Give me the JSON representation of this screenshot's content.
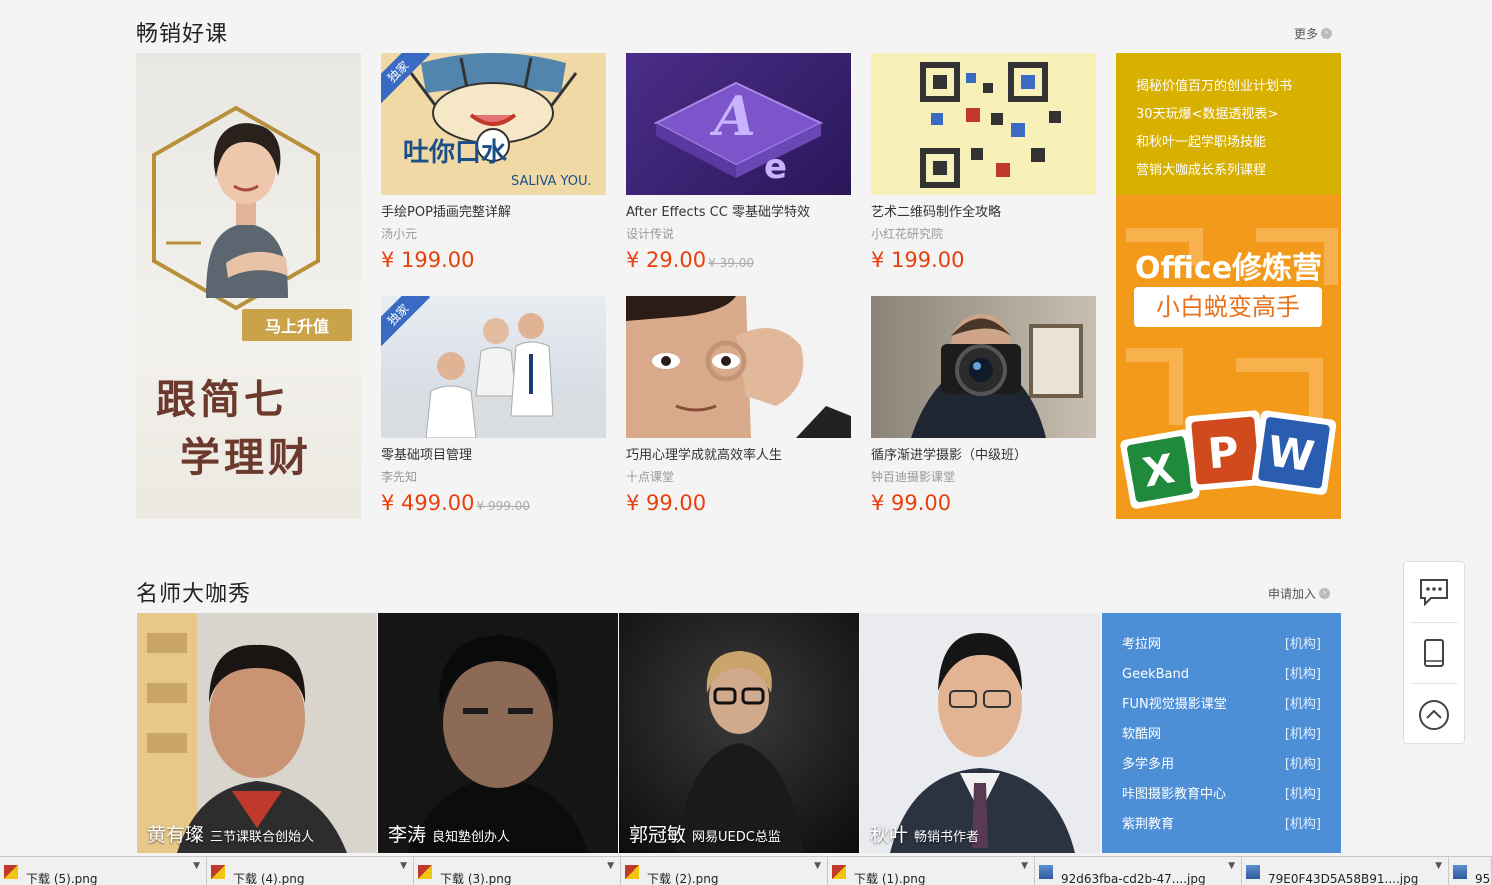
{
  "sections": {
    "bestsellers_title": "畅销好课",
    "bestsellers_more": "更多",
    "teachers_title": "名师大咖秀",
    "teachers_join": "申请加入"
  },
  "promo_left": {
    "badge": "马上升值",
    "title_line1": "跟简七",
    "title_line2": "学理财"
  },
  "courses": [
    {
      "name": "手绘POP插画完整详解",
      "org": "汤小元",
      "price": "¥ 199.00",
      "old_price": "",
      "exclusive": "独家"
    },
    {
      "name": "After Effects CC 零基础学特效",
      "org": "设计传说",
      "price": "¥ 29.00",
      "old_price": "¥ 39.00",
      "exclusive": ""
    },
    {
      "name": "艺术二维码制作全攻略",
      "org": "小红花研究院",
      "price": "¥ 199.00",
      "old_price": "",
      "exclusive": ""
    },
    {
      "name": "零基础项目管理",
      "org": "李先知",
      "price": "¥ 499.00",
      "old_price": "¥ 999.00",
      "exclusive": "独家"
    },
    {
      "name": "巧用心理学成就高效率人生",
      "org": "十点课堂",
      "price": "¥ 99.00",
      "old_price": "",
      "exclusive": ""
    },
    {
      "name": "循序渐进学摄影（中级班）",
      "org": "钟百迪摄影课堂",
      "price": "¥ 99.00",
      "old_price": "",
      "exclusive": ""
    }
  ],
  "thumb_texts": {
    "pop_big": "吐你口水",
    "pop_small": "SALIVA YOU."
  },
  "promo_right": {
    "links": [
      "揭秘价值百万的创业计划书",
      "30天玩爆<数据透视表>",
      "和秋叶一起学职场技能",
      "营销大咖成长系列课程"
    ],
    "office_title": "Office修炼营",
    "office_sub": "小白蜕变高手"
  },
  "teachers": [
    {
      "name": "黄有璨",
      "role": "三节课联合创始人"
    },
    {
      "name": "李涛",
      "role": "良知塾创办人"
    },
    {
      "name": "郭冠敏",
      "role": "网易UEDC总监"
    },
    {
      "name": "秋叶",
      "role": "畅销书作者"
    }
  ],
  "institutions": [
    {
      "name": "考拉网",
      "tag": "[机构]"
    },
    {
      "name": "GeekBand",
      "tag": "[机构]"
    },
    {
      "name": "FUN视觉摄影课堂",
      "tag": "[机构]"
    },
    {
      "name": "软酷网",
      "tag": "[机构]"
    },
    {
      "name": "多学多用",
      "tag": "[机构]"
    },
    {
      "name": "咔图摄影教育中心",
      "tag": "[机构]"
    },
    {
      "name": "紫荆教育",
      "tag": "[机构]"
    }
  ],
  "downloads": [
    "下载 (5).png",
    "下载 (4).png",
    "下载 (3).png",
    "下载 (2).png",
    "下载 (1).png",
    "92d63fba-cd2b-47....jpg",
    "79E0F43D5A58B91....jpg",
    "95"
  ],
  "colors": {
    "price": "#e8400c",
    "institution_panel": "#4d8fd6",
    "promo_yellow": "#d8b000",
    "promo_orange": "#f39a1b"
  }
}
